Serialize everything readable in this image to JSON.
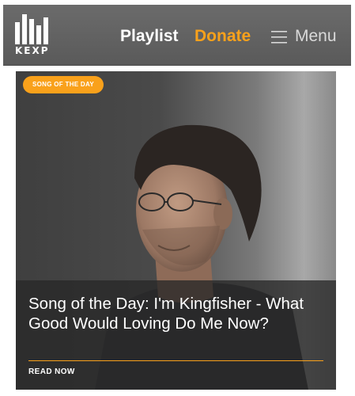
{
  "header": {
    "logo_text": "KEXP",
    "nav": {
      "playlist_label": "Playlist",
      "donate_label": "Donate",
      "menu_label": "Menu"
    },
    "icons": {
      "logo": "kexp-bars-logo",
      "menu": "hamburger-menu-icon"
    }
  },
  "card": {
    "badge": "SONG OF THE DAY",
    "title": "Song of the Day: I'm Kingfisher - What Good Would Loving Do Me Now?",
    "read_more": "READ NOW",
    "image": "portrait-photo"
  },
  "colors": {
    "accent": "#f9a11b",
    "header_bg": "#626262",
    "overlay_bg": "#282828",
    "text_light": "#ffffff"
  }
}
